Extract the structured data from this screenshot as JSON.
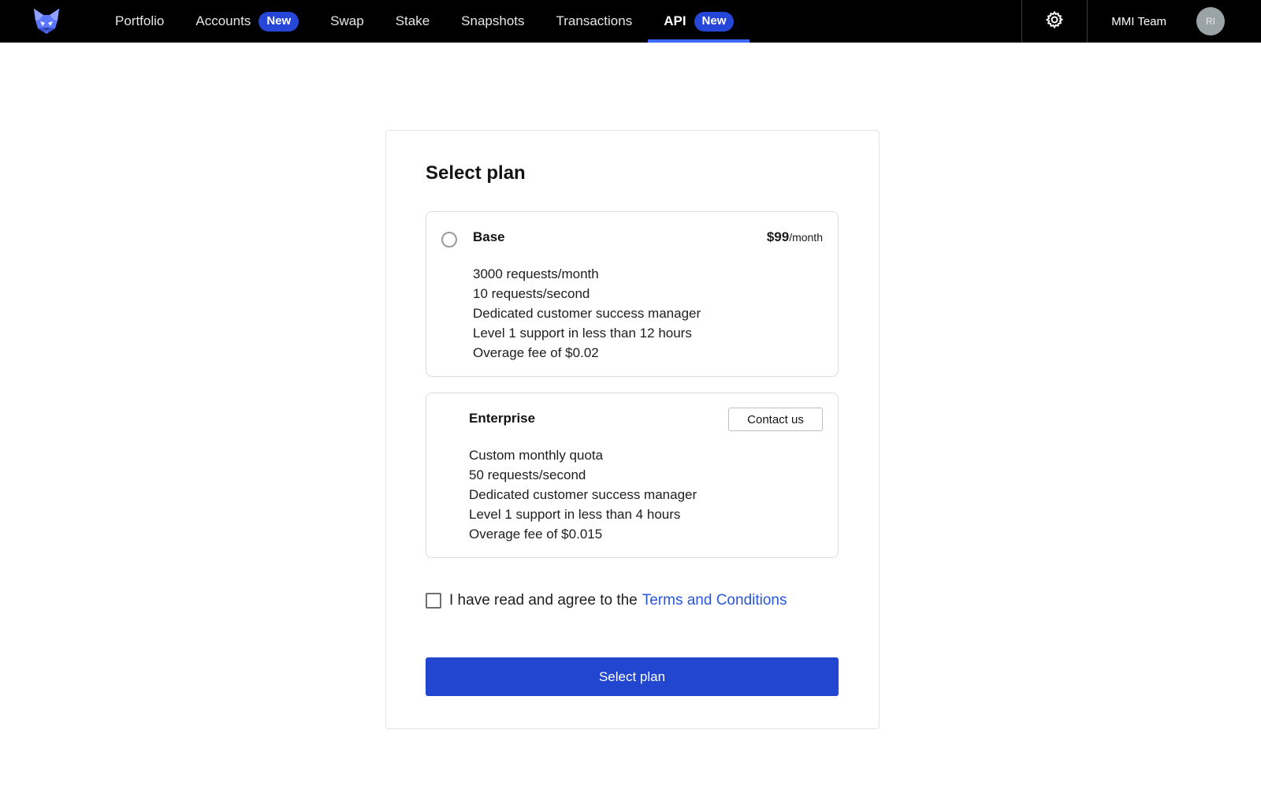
{
  "nav": {
    "items": [
      {
        "label": "Portfolio",
        "badge": null
      },
      {
        "label": "Accounts",
        "badge": "New"
      },
      {
        "label": "Swap",
        "badge": null
      },
      {
        "label": "Stake",
        "badge": null
      },
      {
        "label": "Snapshots",
        "badge": null
      },
      {
        "label": "Transactions",
        "badge": null
      },
      {
        "label": "API",
        "badge": "New"
      }
    ],
    "active": "API",
    "team_name": "MMI Team",
    "avatar_initials": "RI",
    "icons": {
      "logo": "fox-logo",
      "settings": "gear-icon"
    }
  },
  "card": {
    "title": "Select plan",
    "plans": [
      {
        "name": "Base",
        "price": "$99",
        "price_unit": "/month",
        "selected": false,
        "features": [
          "3000 requests/month",
          "10 requests/second",
          "Dedicated customer success manager",
          "Level 1 support in less than 12 hours",
          "Overage fee of $0.02"
        ]
      },
      {
        "name": "Enterprise",
        "action_label": "Contact us",
        "features": [
          "Custom monthly quota",
          "50 requests/second",
          "Dedicated customer success manager",
          "Level 1 support in less than 4 hours",
          "Overage fee of $0.015"
        ]
      }
    ],
    "terms": {
      "prefix": "I have read and agree to the",
      "link": "Terms and Conditions",
      "checked": false
    },
    "submit_label": "Select plan"
  },
  "colors": {
    "nav_bg": "#000000",
    "accent": "#2246d0",
    "active_underline": "#3d68ff",
    "link": "#2a57d8"
  }
}
